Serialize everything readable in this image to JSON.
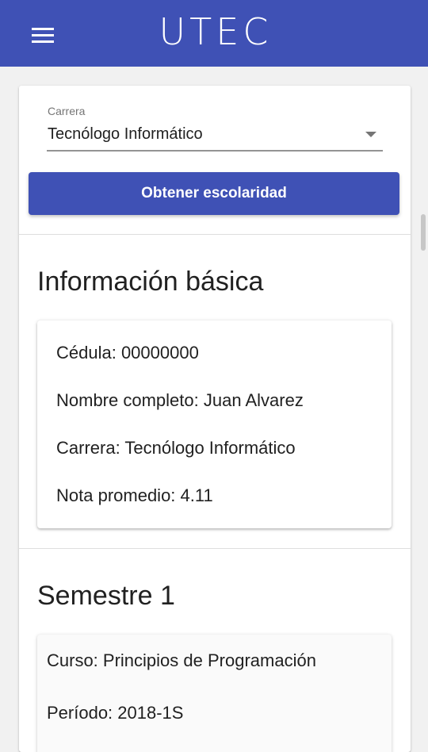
{
  "header": {
    "logo_text": "UTEC",
    "brand_color": "#3f51b5",
    "menu_icon": "hamburger-menu-icon"
  },
  "career_select": {
    "label": "Carrera",
    "value": "Tecnólogo Informático",
    "arrow_icon": "dropdown-arrow-icon"
  },
  "actions": {
    "get_transcript_label": "Obtener escolaridad"
  },
  "basic_info": {
    "title": "Información básica",
    "cedula": "Cédula: 00000000",
    "full_name": "Nombre completo: Juan Alvarez",
    "career": "Carrera: Tecnólogo Informático",
    "average_grade": "Nota promedio: 4.11"
  },
  "semesters": [
    {
      "title": "Semestre 1",
      "course": "Curso: Principios de Programación",
      "period": "Período: 2018-1S"
    }
  ]
}
